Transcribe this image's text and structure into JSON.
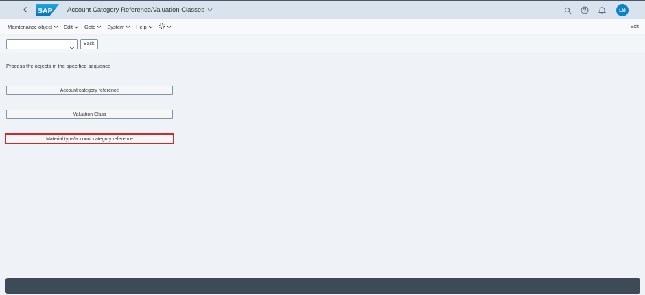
{
  "shell": {
    "title": "Account Category Reference/Valuation Classes",
    "logo_text": "SAP",
    "avatar_initials": "LM"
  },
  "menubar": {
    "items": [
      {
        "label": "Maintenance object"
      },
      {
        "label": "Edit"
      },
      {
        "label": "Goto"
      },
      {
        "label": "System"
      },
      {
        "label": "Help"
      }
    ],
    "exit_label": "Exit"
  },
  "toolbar": {
    "command_value": "",
    "back_label": "Back"
  },
  "content": {
    "instruction": "Process the objects in the specified sequence",
    "objects": [
      {
        "label": "Account category reference"
      },
      {
        "label": "Valuation Class"
      },
      {
        "label": "Material type/account category reference"
      }
    ]
  },
  "colors": {
    "accent": "#0a84c6",
    "highlight": "#cf2a2a",
    "footer": "#3e4a55"
  }
}
